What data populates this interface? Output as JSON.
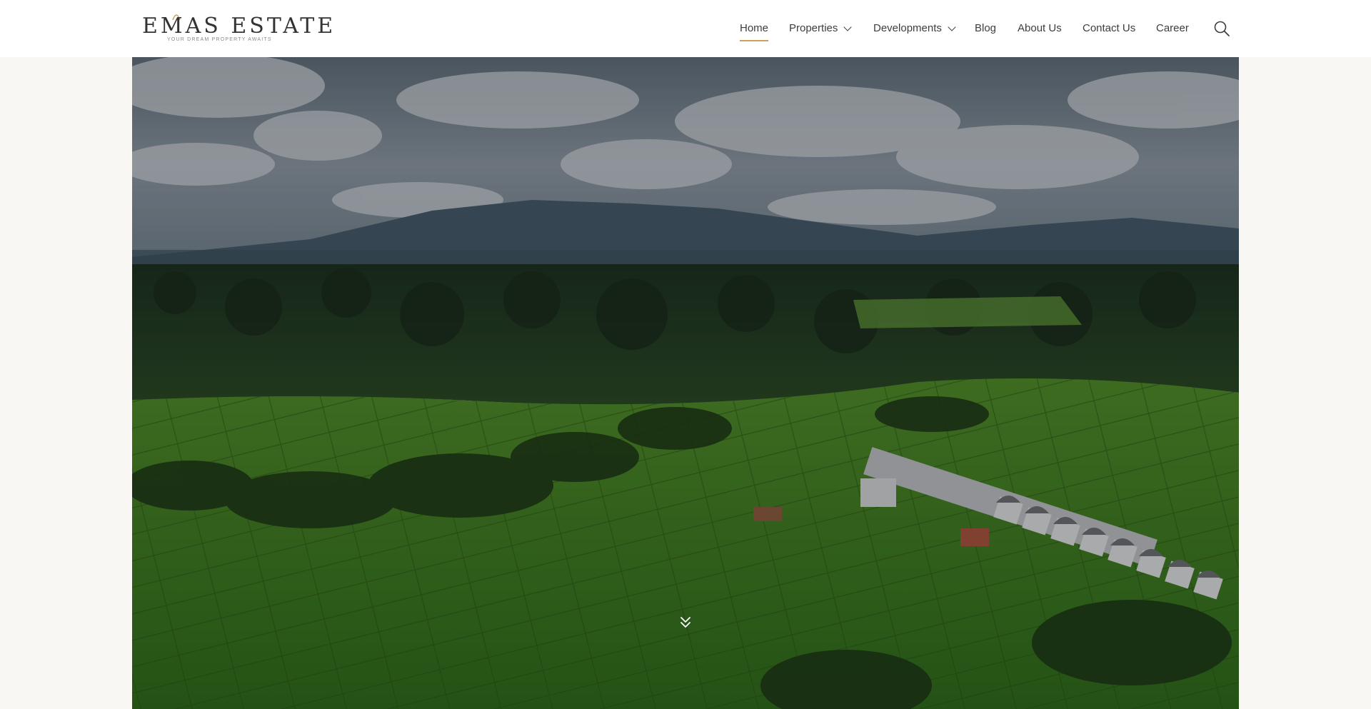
{
  "header": {
    "logo": {
      "name": "EMAS ESTATE",
      "tagline": "YOUR DREAM PROPERTY AWAITS",
      "accent_color": "#c9a25a"
    },
    "nav": {
      "items": [
        {
          "label": "Home",
          "active": true
        },
        {
          "label": "Properties",
          "has_dropdown": true
        },
        {
          "label": "Developments",
          "has_dropdown": true
        },
        {
          "label": "Blog"
        },
        {
          "label": "About Us"
        },
        {
          "label": "Contact Us"
        },
        {
          "label": "Career"
        }
      ],
      "search_icon": "search-icon"
    }
  },
  "hero": {
    "image": "aerial view of rice terraces, jungle and mountains under a cloudy sky",
    "scroll_icon": "double-chevron-down-icon"
  },
  "colors": {
    "accent": "#c9a25a",
    "nav_text": "#3d3d3d",
    "page_bg": "#f8f7f4",
    "header_bg": "#ffffff"
  }
}
